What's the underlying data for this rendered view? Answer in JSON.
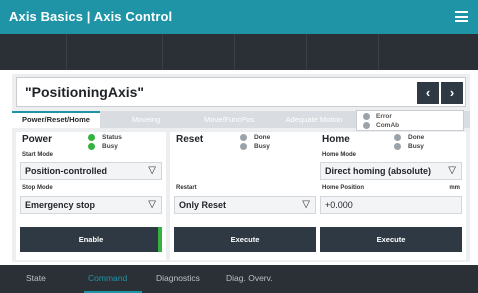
{
  "app": {
    "title": "Axis Basics | Axis Control",
    "menu_icon": "hamburger-menu-icon"
  },
  "axis": {
    "name": "\"PositioningAxis\"",
    "prev_label": "‹",
    "next_label": "›"
  },
  "tabs": [
    {
      "label": "Power/Reset/Home",
      "active": true
    },
    {
      "label": "Moveing",
      "active": false
    },
    {
      "label": "Move/FuncPos",
      "active": false
    },
    {
      "label": "Adequate Motion",
      "active": false
    }
  ],
  "status": {
    "error_label": "Error",
    "comab_label": "ComAb"
  },
  "power": {
    "title": "Power",
    "status_label": "Status",
    "busy_label": "Busy",
    "start_mode_label": "Start Mode",
    "start_mode_value": "Position-controlled",
    "stop_mode_label": "Stop Mode",
    "stop_mode_value": "Emergency stop",
    "button_label": "Enable"
  },
  "reset": {
    "title": "Reset",
    "done_label": "Done",
    "busy_label": "Busy",
    "restart_label": "Restart",
    "restart_value": "Only Reset",
    "button_label": "Execute"
  },
  "home": {
    "title": "Home",
    "done_label": "Done",
    "busy_label": "Busy",
    "home_mode_label": "Home Mode",
    "home_mode_value": "Direct homing (absolute)",
    "home_position_label": "Home Position",
    "unit_label": "mm",
    "home_position_value": "+0.000",
    "button_label": "Execute"
  },
  "bottom_tabs": [
    {
      "label": "State",
      "active": false
    },
    {
      "label": "Command",
      "active": true
    },
    {
      "label": "Diagnostics",
      "active": false
    },
    {
      "label": "Diag. Overv.",
      "active": false
    }
  ],
  "colors": {
    "accent": "#1e94a6",
    "dark": "#2e3944",
    "led_green": "#33b23f",
    "led_gray": "#9aa3aa"
  }
}
